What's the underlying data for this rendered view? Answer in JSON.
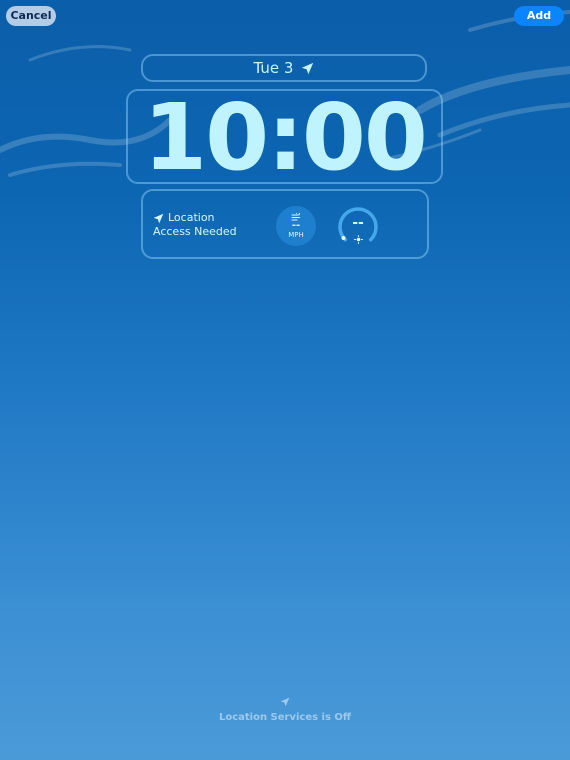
{
  "toolbar": {
    "cancel_label": "Cancel",
    "add_label": "Add"
  },
  "lock_screen": {
    "date": "Tue 3",
    "date_icon": "location-arrow-icon",
    "time": "10:00"
  },
  "widgets": {
    "location": {
      "icon": "location-arrow-icon",
      "line1": "Location",
      "line2": "Access Needed"
    },
    "wind": {
      "icon": "wind-icon",
      "value": "--",
      "unit": "MPH"
    },
    "uv": {
      "icon": "sun-icon",
      "value": "--"
    }
  },
  "status": {
    "icon": "location-arrow-icon",
    "text": "Location Services is Off"
  },
  "colors": {
    "accent": "#0a84ff",
    "time_text": "#bff4ff",
    "widget_border": "#96d7ff"
  }
}
